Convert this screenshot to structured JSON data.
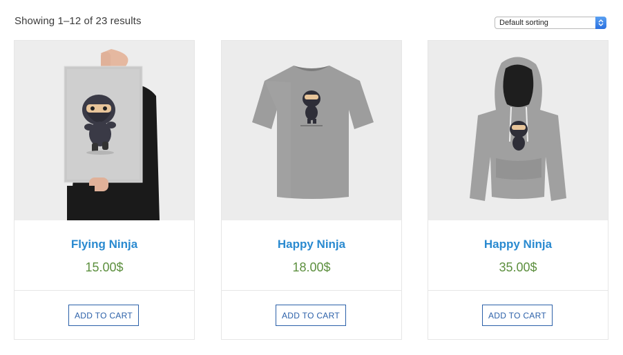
{
  "toolbar": {
    "result_count": "Showing 1–12 of 23 results",
    "sort": {
      "selected": "Default sorting"
    }
  },
  "products": [
    {
      "title": "Flying Ninja",
      "price": "15.00$",
      "button": "ADD TO CART",
      "image_icon": "ninja-poster-image"
    },
    {
      "title": "Happy Ninja",
      "price": "18.00$",
      "button": "ADD TO CART",
      "image_icon": "ninja-tshirt-image"
    },
    {
      "title": "Happy Ninja",
      "price": "35.00$",
      "button": "ADD TO CART",
      "image_icon": "ninja-hoodie-image"
    }
  ],
  "colors": {
    "title": "#2a8ad0",
    "price": "#5c8f3e",
    "button_border": "#2a5fa8",
    "select_accent": "#2a70e0"
  }
}
